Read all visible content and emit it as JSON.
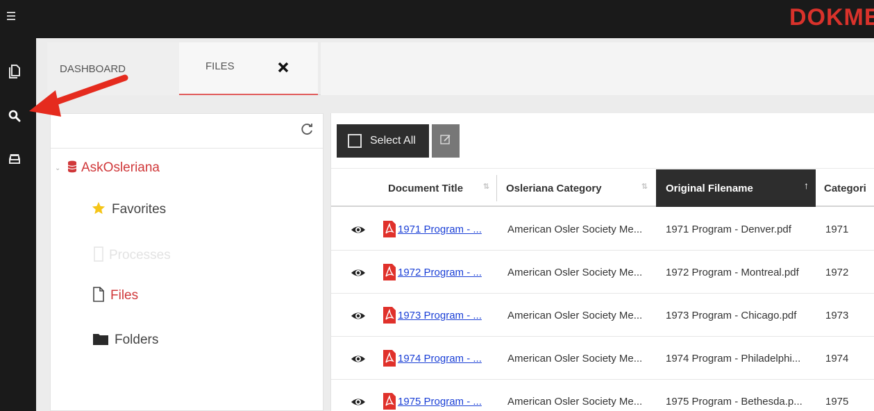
{
  "header": {
    "logo_text": "DOKME",
    "brand_color": "#d9322b"
  },
  "rail": {
    "items": [
      {
        "icon": "files-icon"
      },
      {
        "icon": "search-icon"
      },
      {
        "icon": "inbox-icon"
      }
    ]
  },
  "annotation": {
    "arrow_color": "#e52b1e",
    "points_to": "search-icon"
  },
  "tabs": [
    {
      "label": "DASHBOARD",
      "active": false
    },
    {
      "label": "FILES",
      "active": true,
      "closable": true
    }
  ],
  "tree": {
    "root": {
      "label": "AskOsleriana",
      "icon": "database-icon"
    },
    "items": [
      {
        "label": "Favorites",
        "icon": "star-icon"
      },
      {
        "label": "Processes",
        "icon": "file-icon"
      },
      {
        "label": "Files",
        "icon": "file-outline-icon",
        "active": true
      },
      {
        "label": "Folders",
        "icon": "folder-icon"
      }
    ]
  },
  "toolbar": {
    "select_all_label": "Select All",
    "edit_icon": "edit-icon"
  },
  "table": {
    "columns": [
      {
        "label": "Document Title",
        "sortable": true
      },
      {
        "label": "Osleriana Category",
        "sortable": true
      },
      {
        "label": "Original Filename",
        "sorted": "ascending"
      },
      {
        "label": "Categori"
      }
    ],
    "rows": [
      {
        "title": "1971 Program - ...",
        "category": "American Osler Society Me...",
        "filename": "1971 Program - Denver.pdf",
        "year": "1971"
      },
      {
        "title": "1972 Program - ...",
        "category": "American Osler Society Me...",
        "filename": "1972 Program - Montreal.pdf",
        "year": "1972"
      },
      {
        "title": "1973 Program - ...",
        "category": "American Osler Society Me...",
        "filename": "1973 Program - Chicago.pdf",
        "year": "1973"
      },
      {
        "title": "1974 Program - ...",
        "category": "American Osler Society Me...",
        "filename": "1974 Program - Philadelphi...",
        "year": "1974"
      },
      {
        "title": "1975 Program - ...",
        "category": "American Osler Society Me...",
        "filename": "1975 Program - Bethesda.p...",
        "year": "1975"
      }
    ]
  }
}
